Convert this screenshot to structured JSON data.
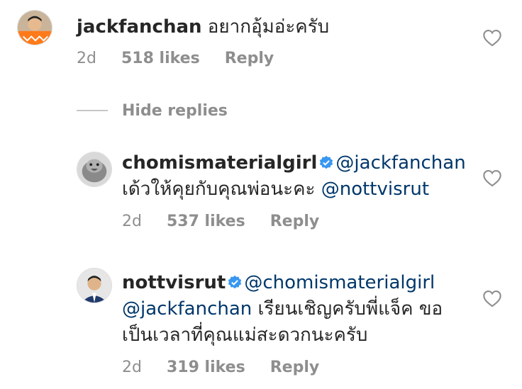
{
  "comments": [
    {
      "username": "jackfanchan",
      "verified": false,
      "lines": [
        {
          "parts": [
            {
              "type": "text",
              "value": "อยากอุ้มอ่ะครับ"
            }
          ]
        }
      ],
      "time": "2d",
      "likes": "518 likes",
      "reply": "Reply",
      "avatar": "avatar-orange-shirt"
    },
    {
      "username": "chomismaterialgirl",
      "verified": true,
      "mention1": "@jackfanchan",
      "line2_text": "เด้วให้คุยกับคุณพ่อนะคะ",
      "line2_mention": "@nottvisrut",
      "time": "2d",
      "likes": "537 likes",
      "reply": "Reply",
      "avatar": "avatar-bird"
    },
    {
      "username": "nottvisrut",
      "verified": true,
      "mention1": "@chomismaterialgirl",
      "line2_mention": "@jackfanchan",
      "line2_text": "เรียนเชิญครับพี่แจ็ค ขอ",
      "line3_text": "เป็นเวลาที่คุณแม่สะดวกนะครับ",
      "time": "2d",
      "likes": "319 likes",
      "reply": "Reply",
      "avatar": "avatar-man-suit"
    }
  ],
  "hide_replies": "Hide replies",
  "colors": {
    "text": "#262626",
    "muted": "#8e8e8e",
    "mention": "#00376b",
    "verified": "#3897f0"
  },
  "icons": {
    "like": "heart-outline-icon",
    "verified": "verified-badge-icon"
  }
}
